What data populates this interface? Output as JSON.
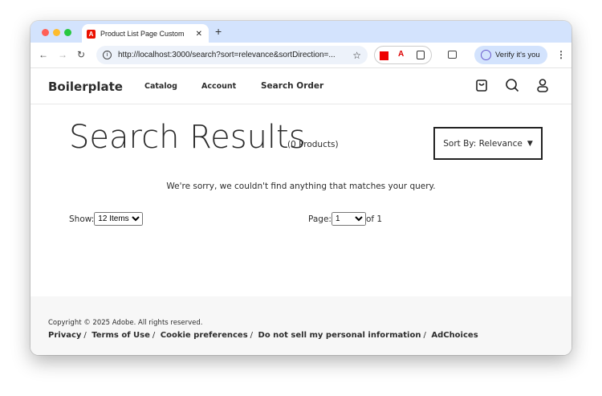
{
  "browser": {
    "tab_title": "Product List Page Custom",
    "url": "http://localhost:3000/search?sort=relevance&sortDirection=...",
    "verify_label": "Verify it's you"
  },
  "header": {
    "logo": "Boilerplate",
    "nav": [
      "Catalog",
      "Account",
      "Search Order"
    ]
  },
  "main": {
    "title": "Search Results",
    "count": "(0 Products)",
    "sort_label": "Sort By: Relevance",
    "message": "We're sorry, we couldn't find anything that matches your query.",
    "show_label": "Show:",
    "show_value": "12 Items",
    "page_label": "Page:",
    "page_value": "1",
    "page_of": "of 1"
  },
  "footer": {
    "copyright": "Copyright © 2025 Adobe. All rights reserved.",
    "links": [
      "Privacy",
      "Terms of Use",
      "Cookie preferences",
      "Do not sell my personal information",
      "AdChoices"
    ],
    "separator": "/"
  }
}
